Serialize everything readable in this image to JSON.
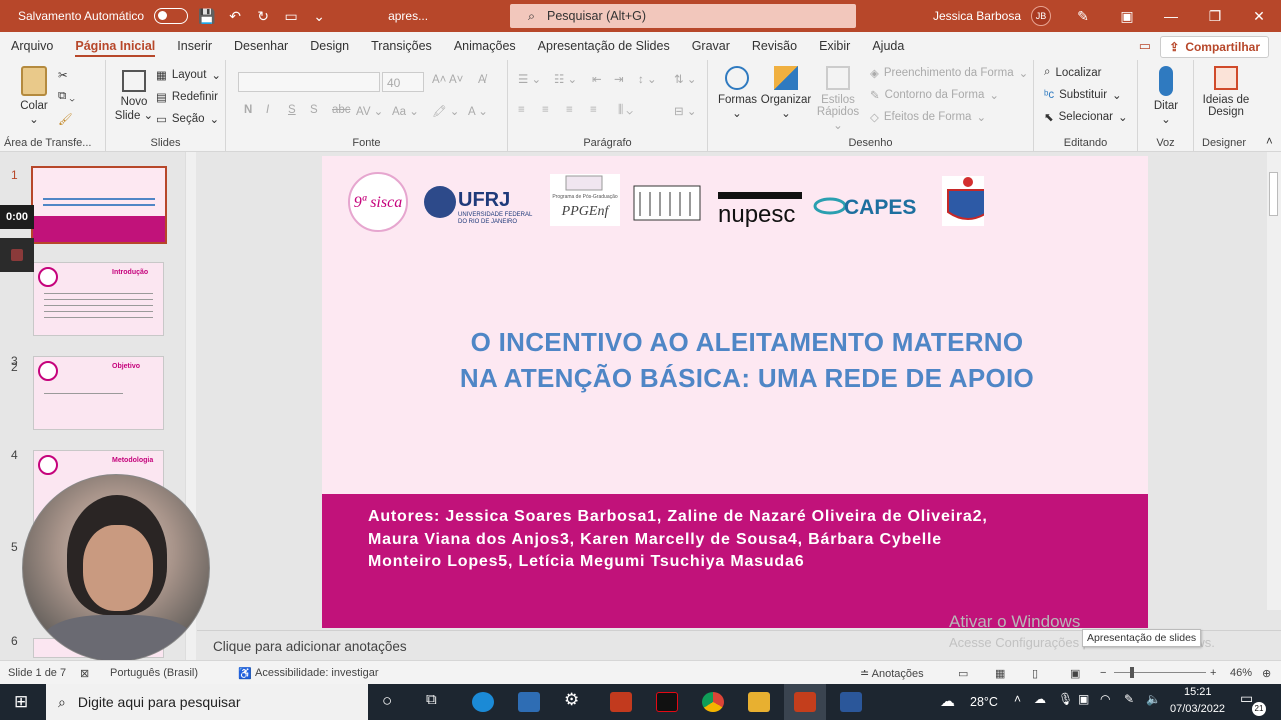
{
  "titlebar": {
    "autosave_label": "Salvamento Automático",
    "doc_name": "apres...",
    "search_placeholder": "Pesquisar (Alt+G)",
    "user_name": "Jessica Barbosa",
    "user_initials": "JB"
  },
  "menu": {
    "tabs": [
      "Arquivo",
      "Página Inicial",
      "Inserir",
      "Desenhar",
      "Design",
      "Transições",
      "Animações",
      "Apresentação de Slides",
      "Gravar",
      "Revisão",
      "Exibir",
      "Ajuda"
    ],
    "share_label": "Compartilhar"
  },
  "ribbon": {
    "clipboard": {
      "paste": "Colar",
      "label": "Área de Transfe..."
    },
    "slides": {
      "new": "Novo",
      "new2": "Slide",
      "layout": "Layout",
      "reset": "Redefinir",
      "section": "Seção",
      "label": "Slides"
    },
    "font": {
      "size": "40",
      "label": "Fonte"
    },
    "paragraph": {
      "label": "Parágrafo"
    },
    "drawing": {
      "shapes": "Formas",
      "arrange": "Organizar",
      "styles1": "Estilos",
      "styles2": "Rápidos",
      "fill": "Preenchimento da Forma",
      "outline": "Contorno da Forma",
      "effects": "Efeitos de Forma",
      "label": "Desenho"
    },
    "editing": {
      "find": "Localizar",
      "replace": "Substituir",
      "select": "Selecionar",
      "label": "Editando"
    },
    "voice": {
      "dictate": "Ditar",
      "label": "Voz"
    },
    "designer": {
      "ideas1": "Ideias de",
      "ideas2": "Design",
      "label": "Designer"
    }
  },
  "thumbnails": {
    "numbers": [
      "1",
      "3",
      "4",
      "5",
      "6"
    ],
    "titles": [
      "Introdução",
      "Objetivo",
      "Metodologia"
    ]
  },
  "recording": {
    "timer": "0:00"
  },
  "slide": {
    "logos": [
      "9ª sisca",
      "UFRJ",
      "UNIVERSIDADE FEDERAL",
      "DO RIO DE JANEIRO",
      "Programa de Pós-Graduação",
      "PPGEnf",
      "nupesc",
      "CAPES"
    ],
    "title_line1": "O INCENTIVO AO ALEITAMENTO MATERNO",
    "title_line2": "NA ATENÇÃO BÁSICA: UMA REDE DE APOIO",
    "authors_line1": "Autores: Jessica Soares Barbosa1, Zaline de Nazaré Oliveira de Oliveira2,",
    "authors_line2": "Maura Viana dos Anjos3, Karen Marcelly de Sousa4, Bárbara Cybelle",
    "authors_line3": "Monteiro Lopes5, Letícia Megumi Tsuchiya Masuda6"
  },
  "notes_placeholder": "Clique para adicionar anotações",
  "watermark": {
    "line1": "Ativar o Windows",
    "line2": "Acesse Configurações para ativar o Windows."
  },
  "tooltip": "Apresentação de slides",
  "status": {
    "slide_info": "Slide 1 de 7",
    "language": "Português (Brasil)",
    "accessibility": "Acessibilidade: investigar",
    "notes_btn": "Anotações",
    "zoom": "46%"
  },
  "taskbar": {
    "search_placeholder": "Digite aqui para pesquisar",
    "temperature": "28°C",
    "time": "15:21",
    "date": "07/03/2022",
    "notif_count": "21"
  }
}
